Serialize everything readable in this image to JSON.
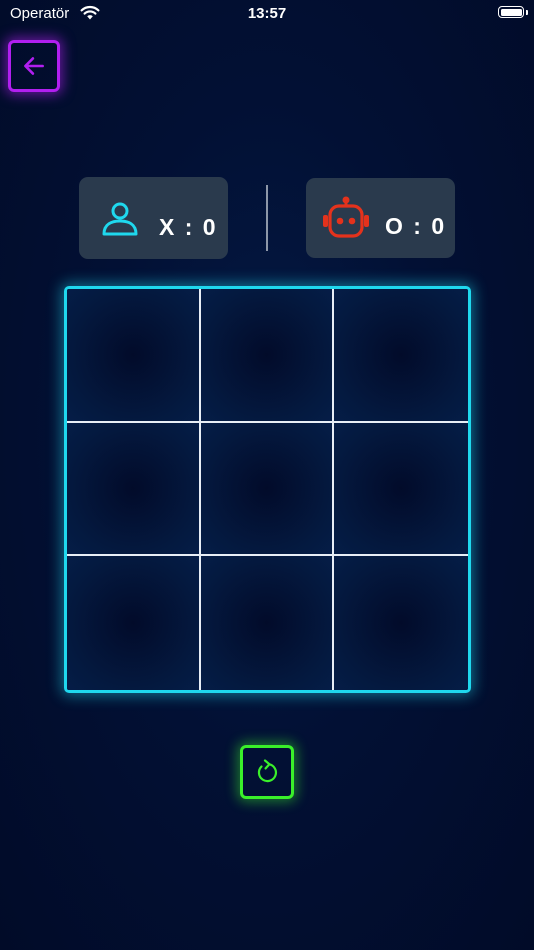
{
  "status_bar": {
    "carrier": "Operatör",
    "time": "13:57",
    "battery_level": 1.0
  },
  "back_button": {
    "icon": "arrow-left-icon",
    "color": "#b11ff0"
  },
  "scoreboard": {
    "player": {
      "icon": "person-icon",
      "label": "X : 0",
      "color": "#1fd8ee"
    },
    "bot": {
      "icon": "robot-icon",
      "label": "O : 0",
      "color": "#e4321c"
    }
  },
  "board": {
    "border_color": "#1fd8ee",
    "cells": [
      [
        "",
        "",
        ""
      ],
      [
        "",
        "",
        ""
      ],
      [
        "",
        "",
        ""
      ]
    ]
  },
  "restart_button": {
    "icon": "restart-icon",
    "color": "#3af02a"
  }
}
